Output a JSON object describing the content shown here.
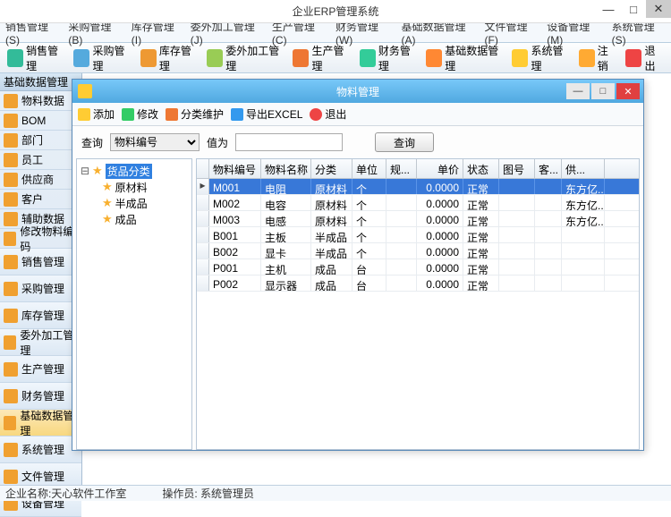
{
  "app": {
    "title": "企业ERP管理系统"
  },
  "menu": [
    "销售管理(S)",
    "采购管理(B)",
    "库存管理(I)",
    "委外加工管理(J)",
    "生产管理(C)",
    "财务管理(W)",
    "基础数据管理(A)",
    "文件管理(F)",
    "设备管理(M)",
    "系统管理(S)"
  ],
  "toolbar": [
    {
      "label": "销售管理"
    },
    {
      "label": "采购管理"
    },
    {
      "label": "库存管理"
    },
    {
      "label": "委外加工管理"
    },
    {
      "label": "生产管理"
    },
    {
      "label": "财务管理"
    },
    {
      "label": "基础数据管理"
    },
    {
      "label": "系统管理"
    },
    {
      "label": "注销"
    },
    {
      "label": "退出"
    }
  ],
  "sidebar": {
    "title": "基础数据管理",
    "top": [
      "物料数据",
      "BOM",
      "部门",
      "员工",
      "供应商",
      "客户",
      "辅助数据",
      "修改物料编码"
    ],
    "bottom": [
      "销售管理",
      "采购管理",
      "库存管理",
      "委外加工管理",
      "生产管理",
      "财务管理",
      "基础数据管理",
      "系统管理",
      "文件管理",
      "设备管理"
    ]
  },
  "child": {
    "title": "物料管理",
    "tools": {
      "add": "添加",
      "edit": "修改",
      "cat": "分类维护",
      "export": "导出EXCEL",
      "exit": "退出"
    },
    "search": {
      "label": "查询",
      "field": "物料编号",
      "value_label": "值为",
      "btn": "查询",
      "value": ""
    },
    "tree": {
      "root": "货品分类",
      "nodes": [
        "原材料",
        "半成品",
        "成品"
      ]
    },
    "columns": [
      "物料编号",
      "物料名称",
      "分类",
      "单位",
      "规...",
      "单价",
      "状态",
      "图号",
      "客...",
      "供..."
    ],
    "rows": [
      {
        "id": "M001",
        "name": "电阻",
        "cat": "原材料",
        "unit": "个",
        "spec": "",
        "price": "0.0000",
        "status": "正常",
        "draw": "",
        "cust": "",
        "supp": "东方亿..."
      },
      {
        "id": "M002",
        "name": "电容",
        "cat": "原材料",
        "unit": "个",
        "spec": "",
        "price": "0.0000",
        "status": "正常",
        "draw": "",
        "cust": "",
        "supp": "东方亿..."
      },
      {
        "id": "M003",
        "name": "电感",
        "cat": "原材料",
        "unit": "个",
        "spec": "",
        "price": "0.0000",
        "status": "正常",
        "draw": "",
        "cust": "",
        "supp": "东方亿..."
      },
      {
        "id": "B001",
        "name": "主板",
        "cat": "半成品",
        "unit": "个",
        "spec": "",
        "price": "0.0000",
        "status": "正常",
        "draw": "",
        "cust": "",
        "supp": ""
      },
      {
        "id": "B002",
        "name": "显卡",
        "cat": "半成品",
        "unit": "个",
        "spec": "",
        "price": "0.0000",
        "status": "正常",
        "draw": "",
        "cust": "",
        "supp": ""
      },
      {
        "id": "P001",
        "name": "主机",
        "cat": "成品",
        "unit": "台",
        "spec": "",
        "price": "0.0000",
        "status": "正常",
        "draw": "",
        "cust": "",
        "supp": ""
      },
      {
        "id": "P002",
        "name": "显示器",
        "cat": "成品",
        "unit": "台",
        "spec": "",
        "price": "0.0000",
        "status": "正常",
        "draw": "",
        "cust": "",
        "supp": ""
      }
    ]
  },
  "status": {
    "company_label": "企业名称:",
    "company": "天心软件工作室",
    "op_label": "操作员:",
    "op": "系统管理员"
  }
}
